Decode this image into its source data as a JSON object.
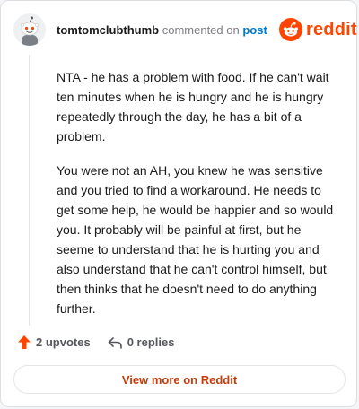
{
  "header": {
    "username": "tomtomclubthumb",
    "action_text": "commented on",
    "post_link": "post",
    "brand_name": "reddit"
  },
  "comment": {
    "paragraphs": [
      "NTA - he has a problem with food. If he can't wait ten minutes when he is hungry and he is hungry repeatedly through the day, he has a bit of a problem.",
      "You were not an AH, you knew he was sensitive and you tried to find a workaround. He needs to get some help, he would be happier and so would you. It probably will be painful at first, but he seeme to understand that he is hurting you and also understand that he can't control himself, but then thinks that he doesn't need to do anything further."
    ]
  },
  "actions": {
    "upvotes": "2 upvotes",
    "replies": "0 replies"
  },
  "footer": {
    "view_more": "View more on Reddit"
  },
  "colors": {
    "brand": "#ff4500",
    "link": "#0079d3",
    "cta": "#c93a08"
  },
  "icons": {
    "avatar": "snoo-avatar",
    "logo": "reddit-logo-icon",
    "upvote": "upvote-arrow-icon",
    "reply": "reply-arrow-icon"
  }
}
